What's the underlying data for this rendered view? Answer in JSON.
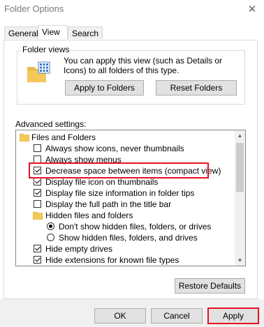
{
  "window": {
    "title": "Folder Options",
    "close_glyph": "✕"
  },
  "tabs": [
    {
      "label": "General",
      "active": false
    },
    {
      "label": "View",
      "active": true
    },
    {
      "label": "Search",
      "active": false
    }
  ],
  "folder_views": {
    "legend": "Folder views",
    "description": "You can apply this view (such as Details or Icons) to all folders of this type.",
    "apply_button": "Apply to Folders",
    "reset_button": "Reset Folders"
  },
  "advanced": {
    "label": "Advanced settings:",
    "items": [
      {
        "type": "folder",
        "label": "Files and Folders"
      },
      {
        "type": "checkbox",
        "checked": false,
        "label": "Always show icons, never thumbnails"
      },
      {
        "type": "checkbox",
        "checked": false,
        "label": "Always show menus"
      },
      {
        "type": "checkbox",
        "checked": true,
        "label": "Decrease space between items (compact view)"
      },
      {
        "type": "checkbox",
        "checked": true,
        "label": "Display file icon on thumbnails"
      },
      {
        "type": "checkbox",
        "checked": true,
        "label": "Display file size information in folder tips"
      },
      {
        "type": "checkbox",
        "checked": false,
        "label": "Display the full path in the title bar"
      },
      {
        "type": "folder",
        "label": "Hidden files and folders"
      },
      {
        "type": "radio",
        "checked": true,
        "label": "Don't show hidden files, folders, or drives"
      },
      {
        "type": "radio",
        "checked": false,
        "label": "Show hidden files, folders, and drives"
      },
      {
        "type": "checkbox",
        "checked": true,
        "label": "Hide empty drives"
      },
      {
        "type": "checkbox",
        "checked": true,
        "label": "Hide extensions for known file types"
      }
    ],
    "restore_button": "Restore Defaults"
  },
  "footer": {
    "ok": "OK",
    "cancel": "Cancel",
    "apply": "Apply"
  },
  "colors": {
    "highlight": "#e81123",
    "folder": "#f5c85a",
    "dialog_bg": "#f0f0f0"
  }
}
